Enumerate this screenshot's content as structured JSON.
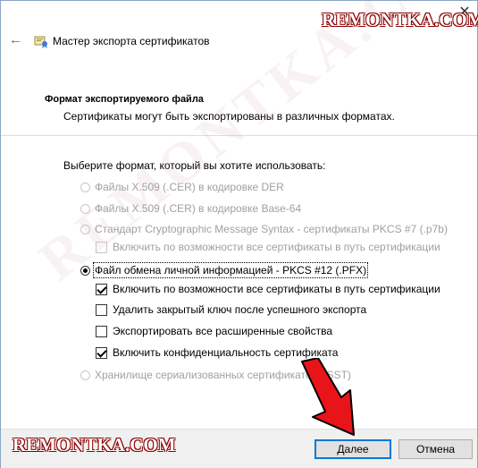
{
  "watermark": {
    "top": "REMONTKA.COM",
    "bottom": "REMONTKA.COM",
    "diagonal": "REMONTKA.COM"
  },
  "window": {
    "close_glyph": "✕"
  },
  "header": {
    "back_glyph": "←",
    "icon": "certificate-wizard-icon",
    "title": "Мастер экспорта сертификатов"
  },
  "section": {
    "title": "Формат экспортируемого файла",
    "description": "Сертификаты могут быть экспортированы в различных форматах."
  },
  "prompt": "Выберите формат, который вы хотите использовать:",
  "options": {
    "der": "Файлы X.509 (.CER) в кодировке DER",
    "base64": "Файлы X.509 (.CER) в кодировке Base-64",
    "pkcs7": "Стандарт Cryptographic Message Syntax - сертификаты PKCS #7 (.p7b)",
    "pkcs7_include": "Включить по возможности все сертификаты в путь сертификации",
    "pfx": "Файл обмена личной информацией - PKCS #12 (.PFX)",
    "pfx_include": "Включить по возможности все сертификаты в путь сертификации",
    "pfx_delete_key": "Удалить закрытый ключ после успешного экспорта",
    "pfx_export_props": "Экспортировать все расширенные свойства",
    "pfx_privacy": "Включить конфиденциальность сертификата",
    "sst": "Хранилище сериализованных сертификатов (.SST)"
  },
  "footer": {
    "next_label": "Далее",
    "cancel_label": "Отмена"
  },
  "colors": {
    "accent": "#0078d7",
    "arrow": "#e8141a",
    "watermark_outline": "#8b0000"
  }
}
